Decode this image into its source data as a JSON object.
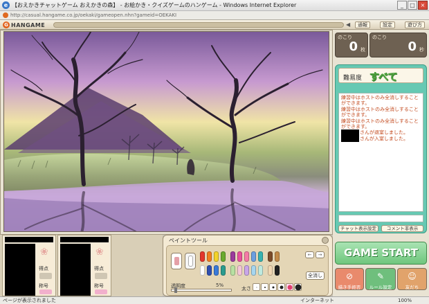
{
  "window": {
    "title": "【おえかきチャットゲーム おえかきの森】 - お絵かき・クイズゲームのハンゲーム - Windows Internet Explorer",
    "url": "http://casual.hangame.co.jp/oekaki/gameopen.nhn?gameid=OEKAKI"
  },
  "header": {
    "logo": "HANGAME",
    "buttons": [
      "通報",
      "設定",
      "遊び方"
    ]
  },
  "counters": {
    "remaining_label": "のこり",
    "remaining_value": "0",
    "remaining_unit": "枚",
    "time_label": "のこり",
    "time_value": "0",
    "time_unit": "秒"
  },
  "difficulty": {
    "label": "難易度",
    "value": "すべて"
  },
  "chat": {
    "messages": [
      "練習中はホストのみ全消しすることができます。",
      "練習中はホストのみ全消しすることができます。",
      "練習中はホストのみ全消しすることができます。"
    ],
    "left_msg": "さんが退室しました。",
    "join_msg": "さんが入室しました。",
    "btn_toggle": "チャット表示設定",
    "btn_comment": "コメント非表示"
  },
  "game_start": "GAME START",
  "bottom_buttons": [
    "描き手拒否",
    "ルール設定",
    "友だち"
  ],
  "player": {
    "label_points": "得点",
    "label_title": "称号"
  },
  "paint": {
    "title": "ペイントツール",
    "clear": "全消し",
    "opacity_label": "透明度",
    "opacity_value": "5%",
    "size_label": "太さ"
  },
  "status": {
    "left": "ページが表示されました",
    "zone": "インターネット",
    "zoom": "100%"
  },
  "colors": {
    "accent": "#66c9b3",
    "game_start": "#6fc67d"
  }
}
